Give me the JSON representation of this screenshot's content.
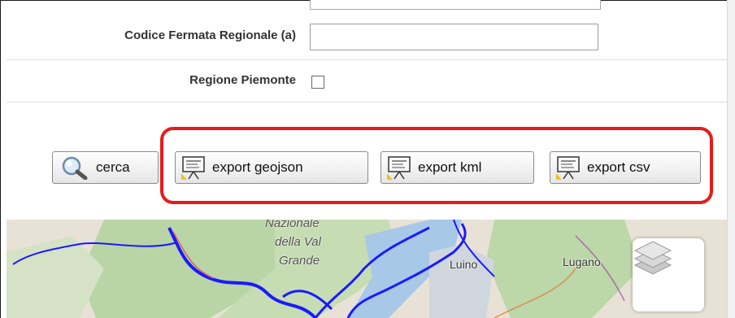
{
  "form": {
    "fields": [
      {
        "label": "Codice Fermata Regionale (a)",
        "value": "",
        "type": "text"
      },
      {
        "label": "Regione Piemonte",
        "checked": false,
        "type": "checkbox"
      }
    ]
  },
  "actions": {
    "search_label": "cerca",
    "export_geojson_label": "export geojson",
    "export_kml_label": "export kml",
    "export_csv_label": "export csv",
    "highlight_color": "#e51c1c"
  },
  "map": {
    "labels": {
      "park_line1": "Nazionale",
      "park_line2": "della Val",
      "park_line3": "Grande",
      "city_luino": "Luino",
      "city_lugano": "Lugano"
    },
    "route_color": "#1a1aff",
    "lake_color": "#a8c8e8",
    "forest_color": "#b9d5a6",
    "layers_control_icon": "layers-icon"
  }
}
